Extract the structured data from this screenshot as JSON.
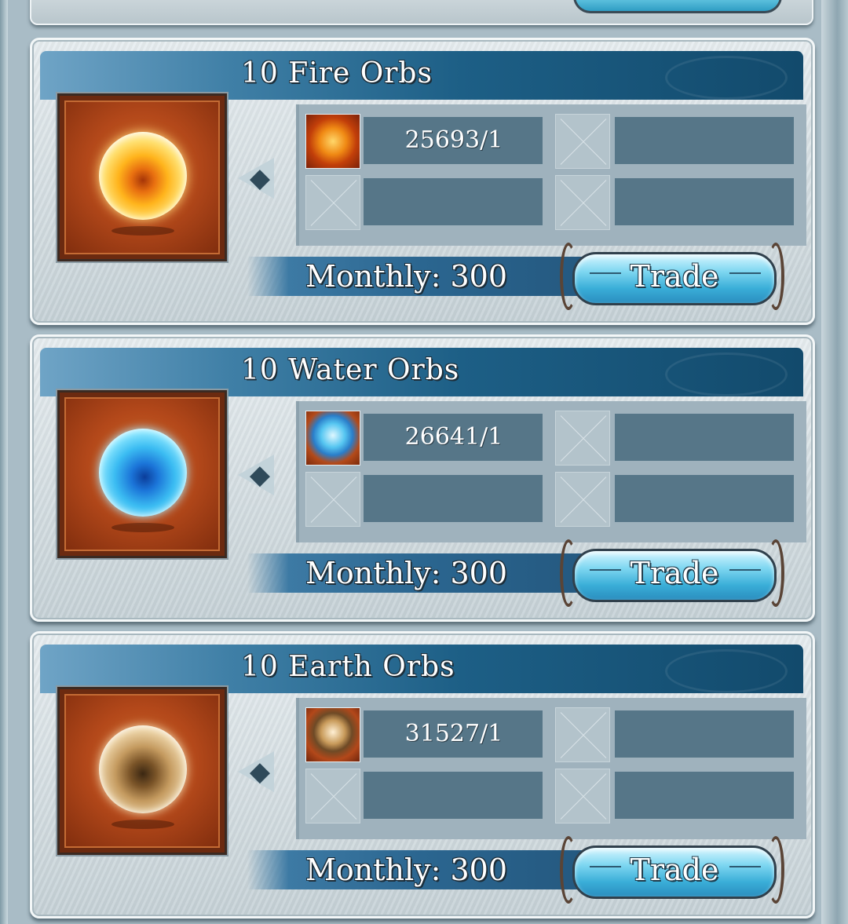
{
  "offers": [
    {
      "title": "10 Fire Orbs",
      "orb": "fire-orb-icon",
      "material": "fire-crystal-icon",
      "count": "25693/1",
      "monthly": "Monthly: 300",
      "trade_label": "Trade"
    },
    {
      "title": "10 Water Orbs",
      "orb": "water-orb-icon",
      "material": "water-crystal-icon",
      "count": "26641/1",
      "monthly": "Monthly: 300",
      "trade_label": "Trade"
    },
    {
      "title": "10 Earth Orbs",
      "orb": "earth-orb-icon",
      "material": "earth-crystal-icon",
      "count": "31527/1",
      "monthly": "Monthly: 300",
      "trade_label": "Trade"
    }
  ],
  "colors": {
    "fire": "#ff9a1a",
    "water": "#3bbcf2",
    "earth": "#d9b98a",
    "title_bar": "#1d5f86",
    "trade_button": "#5cc6ea"
  }
}
